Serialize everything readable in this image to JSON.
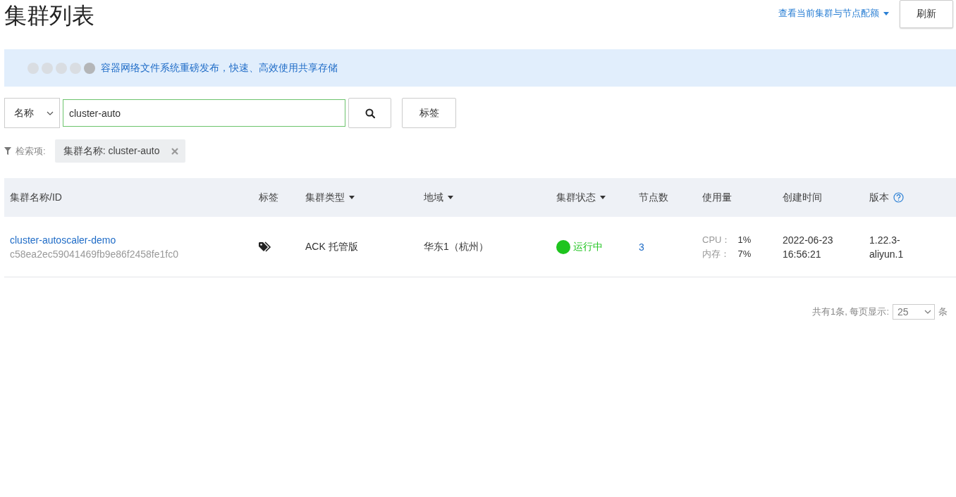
{
  "page_title": "集群列表",
  "quota_link": {
    "label": "查看当前集群与节点配额"
  },
  "refresh_button": {
    "label": "刷新"
  },
  "banner": {
    "dots": [
      {
        "selected": false
      },
      {
        "selected": false
      },
      {
        "selected": false
      },
      {
        "selected": false
      },
      {
        "selected": true
      }
    ],
    "message": "容器网络文件系统重磅发布，快速、高效使用共享存储"
  },
  "search": {
    "field_select": "名称",
    "value": "cluster-auto",
    "tag_button": "标签"
  },
  "filters": {
    "label": "检索项:",
    "tags": [
      {
        "label": "集群名称: cluster-auto"
      }
    ]
  },
  "table": {
    "columns": [
      {
        "label": "集群名称/ID",
        "kind": "plain"
      },
      {
        "label": "标签",
        "kind": "plain"
      },
      {
        "label": "集群类型",
        "kind": "sortable"
      },
      {
        "label": "地域",
        "kind": "sortable"
      },
      {
        "label": "集群状态",
        "kind": "sortable"
      },
      {
        "label": "节点数",
        "kind": "plain"
      },
      {
        "label": "使用量",
        "kind": "plain"
      },
      {
        "label": "创建时间",
        "kind": "plain"
      },
      {
        "label": "版本",
        "kind": "help"
      }
    ],
    "rows": [
      {
        "name": "cluster-autoscaler-demo",
        "id": "c58ea2ec59041469fb9e86f2458fe1fc0",
        "type": "ACK 托管版",
        "region": "华东1（杭州）",
        "status": "运行中",
        "color": "#1ec41e",
        "nodes": "3",
        "usage": [
          {
            "label": "CPU：",
            "value": "1%"
          },
          {
            "label": "内存：",
            "value": "7%"
          }
        ],
        "created": [
          "2022-06-23",
          "16:56:21"
        ],
        "version": [
          "1.22.3-",
          "aliyun.1"
        ]
      }
    ]
  },
  "pagination": {
    "summary": "共有1条, 每页显示:",
    "page_size": "25",
    "unit": "条"
  }
}
